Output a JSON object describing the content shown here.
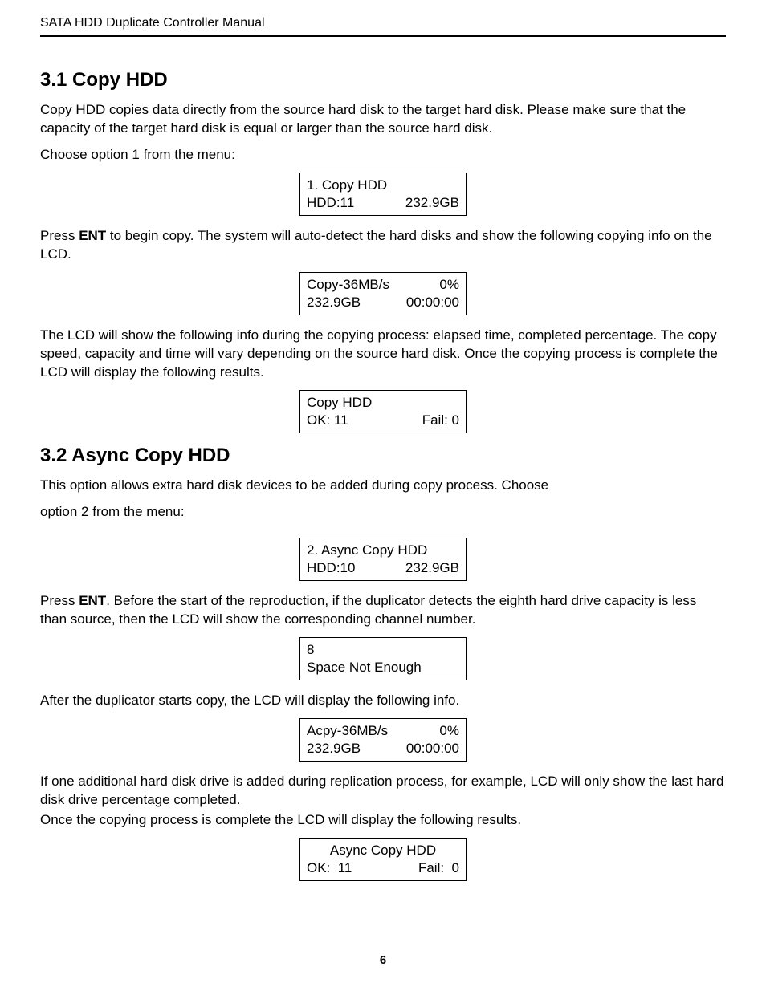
{
  "header": "SATA HDD Duplicate Controller Manual",
  "s1": {
    "heading": "3.1 Copy HDD",
    "p1": "Copy HDD copies data directly from the source hard disk to the target hard disk. Please make sure that the capacity of the target hard disk is equal or larger than the source hard disk.",
    "p2": "Choose option 1 from the menu:",
    "lcd1_l1": "1. Copy HDD",
    "lcd1_l2a": "HDD:11",
    "lcd1_l2b": "232.9GB",
    "p3a": "Press ",
    "p3ent": "ENT",
    "p3b": " to begin copy. The system will auto-detect the hard disks and show the following copying info on the LCD.",
    "lcd2_l1a": "Copy-36MB/s",
    "lcd2_l1b": "0%",
    "lcd2_l2a": "232.9GB",
    "lcd2_l2b": "00:00:00",
    "p4": "The LCD will show the following info during the copying process: elapsed time, completed percentage. The copy speed, capacity and time will vary depending on the source hard disk. Once the copying process is complete the LCD will display the following results.",
    "lcd3_l1": "Copy HDD",
    "lcd3_l2a": "OK: 11",
    "lcd3_l2b": "Fail: 0"
  },
  "s2": {
    "heading": "3.2 Async Copy HDD",
    "p1": "This option allows extra hard disk devices to be added during copy process. Choose",
    "p1b": "option 2 from the menu:",
    "lcd1_l1": "2. Async Copy HDD",
    "lcd1_l2a": "HDD:10",
    "lcd1_l2b": "232.9GB",
    "p2a": "Press ",
    "p2ent": "ENT",
    "p2b": ". Before the start of the reproduction, if the duplicator detects the eighth hard drive capacity is less than source, then the LCD will show the corresponding channel number.",
    "lcd2_l1": "8",
    "lcd2_l2": "Space Not Enough",
    "p3": "After the duplicator starts copy, the LCD will display the following info.",
    "lcd3_l1a": "Acpy-36MB/s",
    "lcd3_l1b": "0%",
    "lcd3_l2a": "232.9GB",
    "lcd3_l2b": "00:00:00",
    "p4": "If one additional hard disk drive is added during replication process, for example, LCD will only show the last hard disk drive percentage completed.",
    "p5": "Once the copying process is complete the LCD will display the following results.",
    "lcd4_l1": "Async Copy HDD",
    "lcd4_l2a": "OK:  11",
    "lcd4_l2b": "Fail:  0"
  },
  "page_number": "6"
}
